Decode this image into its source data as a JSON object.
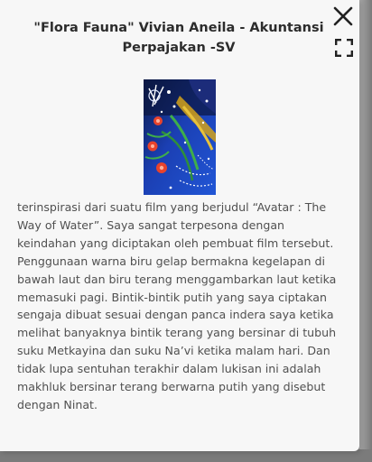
{
  "modal": {
    "title": "\"Flora Fauna\" Vivian Aneila - Akuntansi Perpajakan -SV",
    "close_icon": "close-icon",
    "fullscreen_icon": "fullscreen-icon",
    "description": "terinspirasi dari suatu film yang berjudul “Avatar : The Way of Water”. Saya sangat terpesona dengan keindahan yang diciptakan oleh pembuat film tersebut. Penggunaan warna biru gelap bermakna kegelapan di bawah laut dan biru terang menggambarkan laut ketika memasuki pagi. Bintik-bintik putih yang saya ciptakan sengaja dibuat sesuai dengan panca indera saya ketika melihat banyaknya bintik terang yang bersinar di tubuh suku Metkayina dan suku Na’vi ketika malam hari. Dan tidak lupa sentuhan terakhir dalam lukisan ini adalah makhluk bersinar terang berwarna putih yang disebut dengan Ninat."
  },
  "colors": {
    "modal_background": "#f7f7f7",
    "title_text": "#2c2c2c",
    "body_text": "#505050",
    "icon": "#222222",
    "painting_blue": "#1b3fb3",
    "painting_dark": "#0a1a4a",
    "painting_red": "#e8432c",
    "painting_green": "#3fae4a"
  }
}
